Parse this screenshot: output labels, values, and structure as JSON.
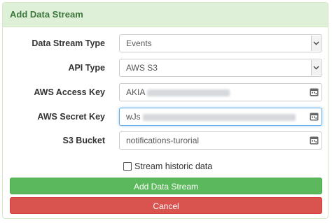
{
  "panel": {
    "title": "Add Data Stream"
  },
  "form": {
    "stream_type": {
      "label": "Data Stream Type",
      "value": "Events"
    },
    "api_type": {
      "label": "API Type",
      "value": "AWS S3"
    },
    "access_key": {
      "label": "AWS Access Key",
      "value_visible": "AKIA"
    },
    "secret_key": {
      "label": "AWS Secret Key",
      "value_visible": "wJs"
    },
    "s3_bucket": {
      "label": "S3 Bucket",
      "value": "notifications-turorial"
    },
    "stream_historic": {
      "label": "Stream historic data",
      "checked": false
    }
  },
  "buttons": {
    "add_label": "Add Data Stream",
    "cancel_label": "Cancel"
  },
  "colors": {
    "heading_bg": "#dff0d8",
    "heading_text": "#3c763d",
    "success": "#5cb85c",
    "danger": "#d9534f",
    "focus": "#66afe9"
  },
  "icons": {
    "select": "chevron-down-icon",
    "key_field": "password-manager-icon"
  }
}
